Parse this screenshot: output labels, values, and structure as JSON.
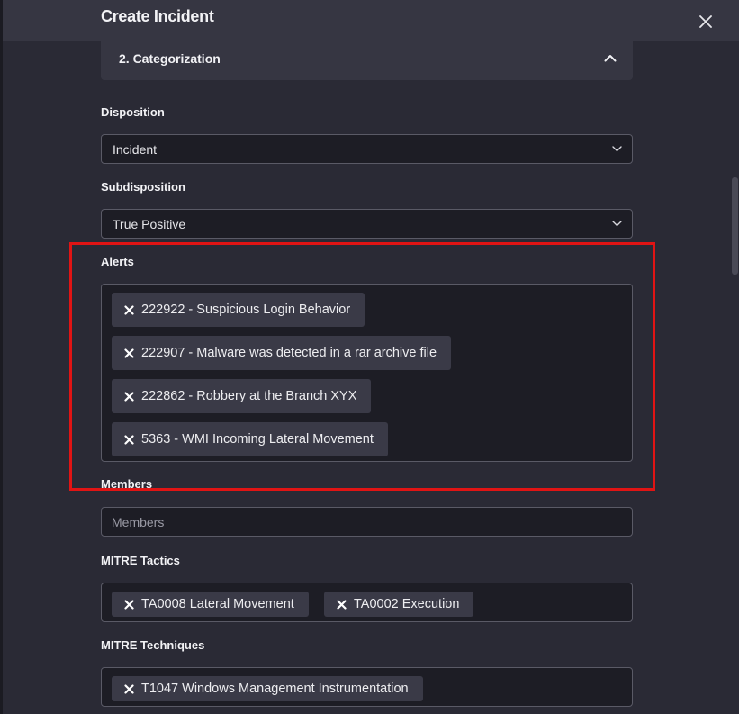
{
  "modal": {
    "title": "Create Incident"
  },
  "section": {
    "title": "2. Categorization"
  },
  "disposition": {
    "label": "Disposition",
    "value": "Incident"
  },
  "subdisposition": {
    "label": "Subdisposition",
    "value": "True Positive"
  },
  "alerts": {
    "label": "Alerts",
    "items": [
      "222922 - Suspicious Login Behavior",
      "222907 - Malware was detected in a rar archive file",
      "222862 - Robbery at the Branch XYX",
      "5363 - WMI Incoming Lateral Movement"
    ]
  },
  "members": {
    "label": "Members",
    "placeholder": "Members"
  },
  "mitre_tactics": {
    "label": "MITRE Tactics",
    "items": [
      "TA0008 Lateral Movement",
      "TA0002 Execution"
    ]
  },
  "mitre_techniques": {
    "label": "MITRE Techniques",
    "items": [
      "T1047 Windows Management Instrumentation"
    ]
  },
  "colors": {
    "highlight": "#e01414",
    "panel": "#2a2a35",
    "field": "#1d1d25",
    "tag": "#3a3a47"
  },
  "icons": {
    "close": "close-icon",
    "collapse": "chevron-up-icon",
    "dropdown": "chevron-down-icon",
    "remove": "x-mark-icon"
  }
}
